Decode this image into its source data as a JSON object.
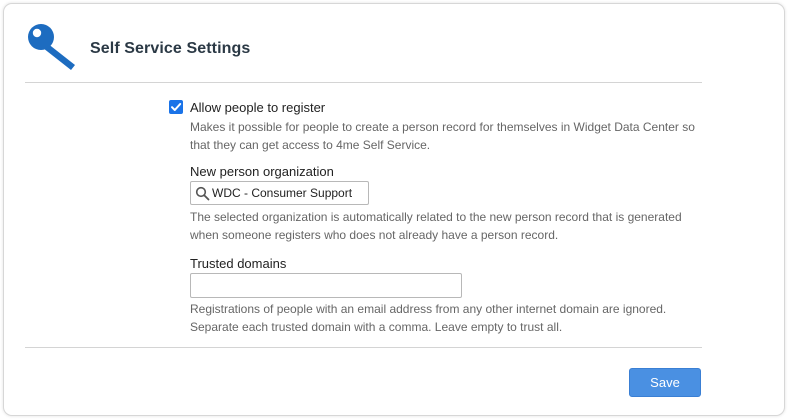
{
  "header": {
    "title": "Self Service Settings",
    "icon": "key-icon",
    "icon_color": "#1d6cc0"
  },
  "registration": {
    "checked": true,
    "label": "Allow people to register",
    "help": "Makes it possible for people to create a person record for themselves in Widget Data Center so that they can get access to 4me Self Service."
  },
  "organization": {
    "label": "New person organization",
    "value": "WDC - Consumer Support",
    "icon": "search-icon",
    "help": "The selected organization is automatically related to the new person record that is generated when someone registers who does not already have a person record."
  },
  "trusted_domains": {
    "label": "Trusted domains",
    "value": "",
    "help": "Registrations of people with an email address from any other internet domain are ignored. Separate each trusted domain with a comma. Leave empty to trust all."
  },
  "actions": {
    "save_label": "Save",
    "save_color": "#4a90e2"
  }
}
